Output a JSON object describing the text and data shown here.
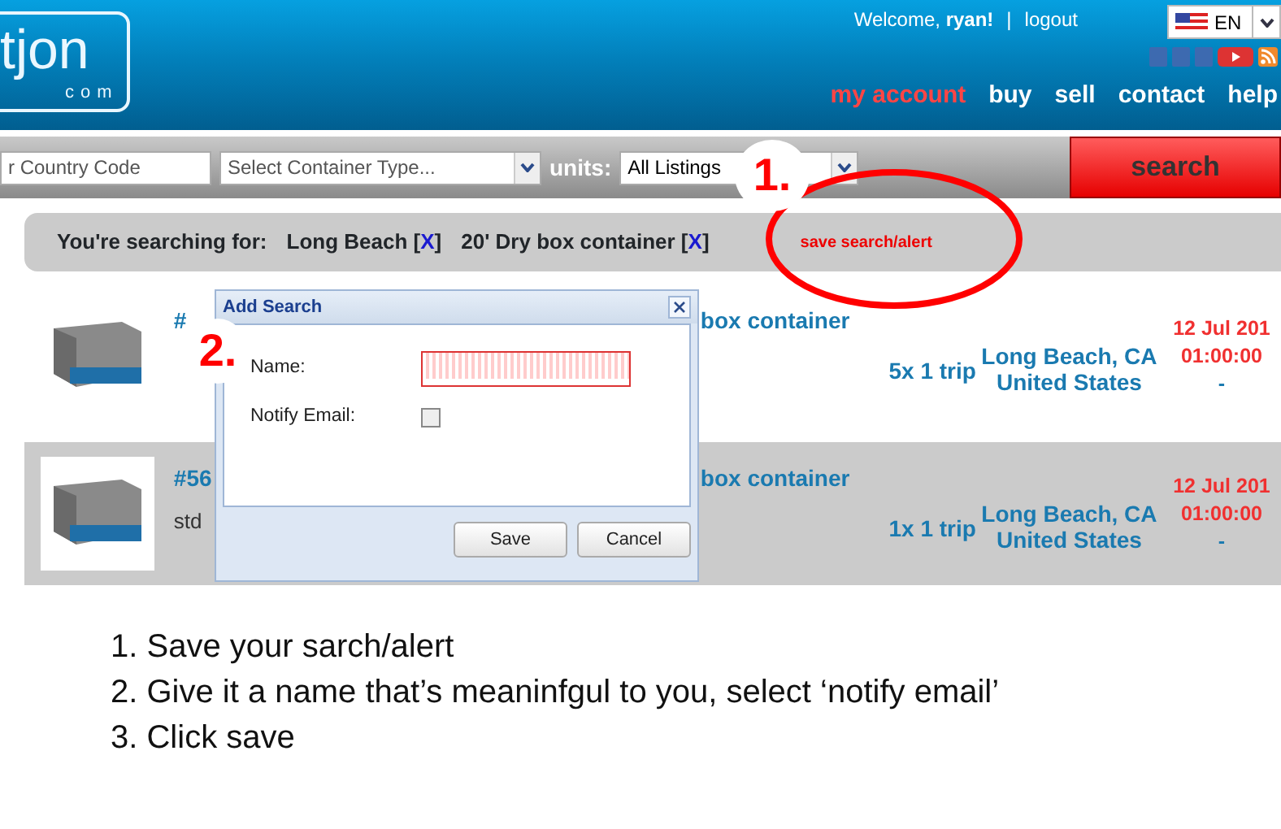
{
  "header": {
    "logo": {
      "main": "tjon",
      "sub": "com"
    },
    "welcome": {
      "greeting": "Welcome,",
      "user": "ryan!",
      "separator": "|",
      "logout": "logout"
    },
    "language": {
      "code": "EN"
    },
    "nav": [
      {
        "label": "my account",
        "selected": true
      },
      {
        "label": "buy",
        "selected": false
      },
      {
        "label": "sell",
        "selected": false
      },
      {
        "label": "contact",
        "selected": false
      },
      {
        "label": "help",
        "selected": false
      }
    ]
  },
  "search_bar": {
    "location": {
      "value": "r Country Code"
    },
    "container_type": {
      "value": "Select Container Type..."
    },
    "units_label": "units:",
    "units": {
      "value": "All Listings"
    },
    "search_button": "search"
  },
  "summary": {
    "label": "You're searching for:",
    "filters": [
      {
        "label": "Long Beach",
        "open": "[",
        "remove": "X",
        "close": "]"
      },
      {
        "label": "20' Dry box container",
        "open": "[",
        "remove": "X",
        "close": "]"
      }
    ],
    "save_link": "save search/alert"
  },
  "listings": [
    {
      "id": "#",
      "title_end": "box container",
      "quantity": "5x 1 trip",
      "city": "Long Beach, CA",
      "country": "United States",
      "date": "12 Jul 201",
      "time": "01:00:00",
      "dash": "-",
      "shaded": false
    },
    {
      "id": "#56",
      "title_end": "box container",
      "description": "std",
      "quantity": "1x 1 trip",
      "city": "Long Beach, CA",
      "country": "United States",
      "date": "12 Jul 201",
      "time": "01:00:00",
      "dash": "-",
      "shaded": true
    }
  ],
  "dialog": {
    "title": "Add Search",
    "fields": [
      {
        "kind": "text",
        "label": "Name:",
        "invalid": true
      },
      {
        "kind": "checkbox",
        "label": "Notify Email:",
        "checked": false
      }
    ],
    "buttons": [
      "Save",
      "Cancel"
    ]
  },
  "annotations": [
    {
      "number": "1."
    },
    {
      "number": "2."
    }
  ],
  "instructions": [
    "1. Save your sarch/alert",
    "2. Give it a name that’s meaninfgul to you, select ‘notify email’",
    "3. Click save"
  ]
}
